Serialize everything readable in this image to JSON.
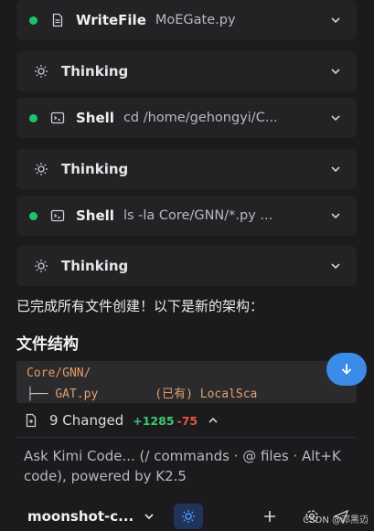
{
  "tool_calls": [
    {
      "kind": "tool",
      "status_color": "#20c36a",
      "icon": "file-icon",
      "tool": "WriteFile",
      "arg": "MoEGate.py"
    },
    {
      "kind": "thinking",
      "icon": "lightbulb-icon",
      "label": "Thinking"
    },
    {
      "kind": "tool",
      "status_color": "#20c36a",
      "icon": "terminal-icon",
      "tool": "Shell",
      "arg": "cd /home/gehongyi/C..."
    },
    {
      "kind": "thinking",
      "icon": "lightbulb-icon",
      "label": "Thinking"
    },
    {
      "kind": "tool",
      "status_color": "#20c36a",
      "icon": "terminal-icon",
      "tool": "Shell",
      "arg": "ls -la Core/GNN/*.py ..."
    },
    {
      "kind": "thinking",
      "icon": "lightbulb-icon",
      "label": "Thinking"
    }
  ],
  "message": {
    "text": "已完成所有文件创建！以下是新的架构：",
    "heading": "文件结构",
    "code_line1": "Core/GNN/",
    "code_line2_tree": "├── ",
    "code_line2_file": "GAT.py",
    "code_line2_note": "(已有) LocalSca"
  },
  "changes": {
    "label": "9 Changed",
    "added": "+1285",
    "removed": "-75"
  },
  "input": {
    "placeholder": "Ask Kimi Code... (/ commands · @ files · Alt+K code), powered by K2.5"
  },
  "footer": {
    "model": "moonshot-c...",
    "watermark": "CSDN @邓黑迈"
  },
  "colors": {
    "accent": "#3b8be8",
    "success": "#20c36a",
    "added": "#3ec76f",
    "removed": "#e5534b",
    "code_path": "#e69a62"
  }
}
